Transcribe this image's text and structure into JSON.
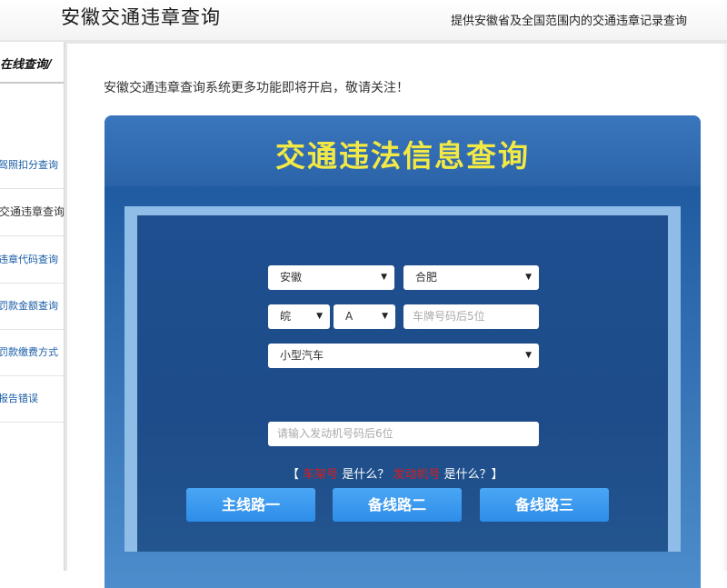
{
  "header": {
    "title": "安徽交通违章查询",
    "tagline": "提供安徽省及全国范围内的交通违章记录查询"
  },
  "sidebar": {
    "heading": "在线查询/",
    "items": [
      {
        "label": "驾照扣分查询"
      },
      {
        "label": "交通违章查询"
      },
      {
        "label": "违章代码查询"
      },
      {
        "label": "罚款金额查询"
      },
      {
        "label": "罚款缴费方式"
      },
      {
        "label": "报告错误"
      }
    ]
  },
  "main": {
    "notice": "安徽交通违章查询系统更多功能即将开启，敬请关注！"
  },
  "panel": {
    "title": "交通违法信息查询",
    "province": "安徽",
    "city": "合肥",
    "plate_prefix": "皖",
    "plate_letter": "A",
    "plate_placeholder": "车牌号码后5位",
    "vehicle_type": "小型汽车",
    "engine_placeholder": "请输入发动机号码后6位",
    "help": {
      "open": "【",
      "vin_link": "车架号",
      "vin_q": "是什么？",
      "engine_link": "发动机号",
      "engine_q": "是什么？】"
    },
    "buttons": [
      "主线路一",
      "备线路二",
      "备线路三"
    ],
    "colors": {
      "title": "#f3e945",
      "link": "#d71c1c",
      "button": "#3a9af0",
      "panel": "#2b63a8"
    }
  }
}
